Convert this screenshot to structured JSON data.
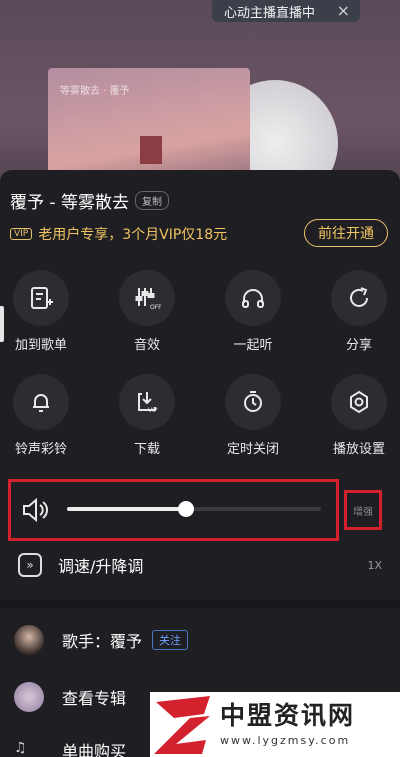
{
  "live_banner": {
    "text": "心动主播直播中",
    "close": "×"
  },
  "cover": {
    "caption": "等雾散去 · 覆予"
  },
  "song": {
    "title": "覆予 - 等雾散去",
    "copy_label": "复制"
  },
  "vip": {
    "badge": "VIP",
    "text": "老用户专享，3个月VIP仅18元",
    "button": "前往开通"
  },
  "actions_row1": [
    {
      "label": "加到歌单",
      "icon": "add-to-playlist-icon"
    },
    {
      "label": "音效",
      "icon": "equalizer-off-icon"
    },
    {
      "label": "一起听",
      "icon": "headphones-icon"
    },
    {
      "label": "分享",
      "icon": "share-icon"
    }
  ],
  "actions_row2": [
    {
      "label": "铃声彩铃",
      "icon": "bell-icon"
    },
    {
      "label": "下载",
      "icon": "download-vip-icon"
    },
    {
      "label": "定时关闭",
      "icon": "timer-icon"
    },
    {
      "label": "播放设置",
      "icon": "settings-icon"
    }
  ],
  "volume": {
    "level": 0.47,
    "boost_label": "增强"
  },
  "speed": {
    "label": "调速/升降调",
    "value": "1X",
    "icon_glyph": "»"
  },
  "singer": {
    "label": "歌手：覆予",
    "follow": "关注"
  },
  "album": {
    "label": "查看专辑"
  },
  "buy": {
    "label": "单曲购买"
  },
  "watermark": {
    "name": "中盟资讯网",
    "url": "www.lygzmsy.com"
  },
  "colors": {
    "accent_gold": "#f0c460",
    "highlight_red": "#d3222d",
    "follow_blue": "#6fa2ff"
  }
}
